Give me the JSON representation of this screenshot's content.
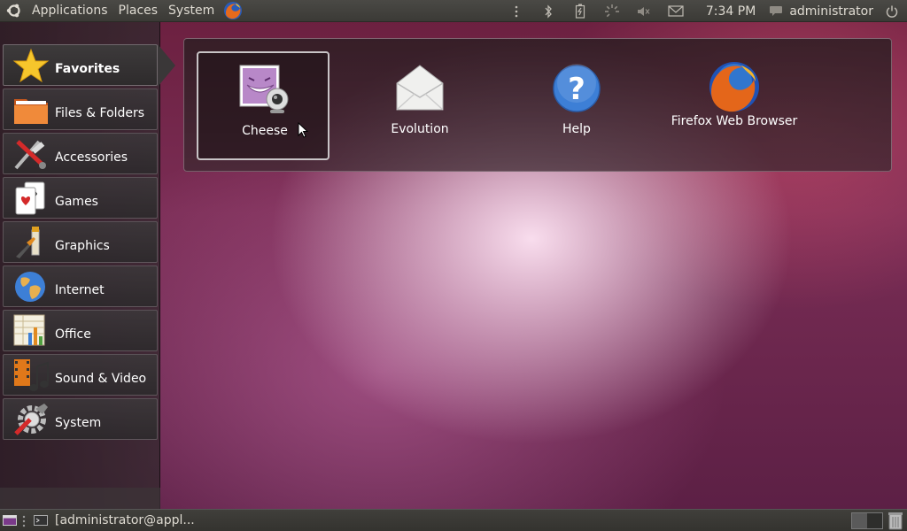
{
  "top_panel": {
    "menus": [
      "Applications",
      "Places",
      "System"
    ],
    "clock": "7:34 PM",
    "user": "administrator",
    "icons": [
      "ubuntu-logo-icon",
      "firefox-icon",
      "indicator-dots-icon",
      "bluetooth-icon",
      "battery-icon",
      "network-icon",
      "volume-icon",
      "mail-icon",
      "chat-icon",
      "power-icon"
    ]
  },
  "sidebar": {
    "items": [
      {
        "label": "Favorites",
        "icon": "star-icon"
      },
      {
        "label": "Files & Folders",
        "icon": "folder-icon"
      },
      {
        "label": "Accessories",
        "icon": "accessories-icon"
      },
      {
        "label": "Games",
        "icon": "cards-icon"
      },
      {
        "label": "Graphics",
        "icon": "graphics-icon"
      },
      {
        "label": "Internet",
        "icon": "globe-icon"
      },
      {
        "label": "Office",
        "icon": "office-icon"
      },
      {
        "label": "Sound & Video",
        "icon": "sound-video-icon"
      },
      {
        "label": "System",
        "icon": "system-icon"
      }
    ]
  },
  "favorites": {
    "apps": [
      {
        "label": "Cheese",
        "icon": "cheese-icon"
      },
      {
        "label": "Evolution",
        "icon": "evolution-icon"
      },
      {
        "label": "Help",
        "icon": "help-icon"
      },
      {
        "label": "Firefox Web Browser",
        "icon": "firefox-icon"
      }
    ]
  },
  "bottom_panel": {
    "task_title": "[administrator@appl..."
  },
  "colors": {
    "panel": "#3b3a36",
    "accent": "#dd4814"
  }
}
